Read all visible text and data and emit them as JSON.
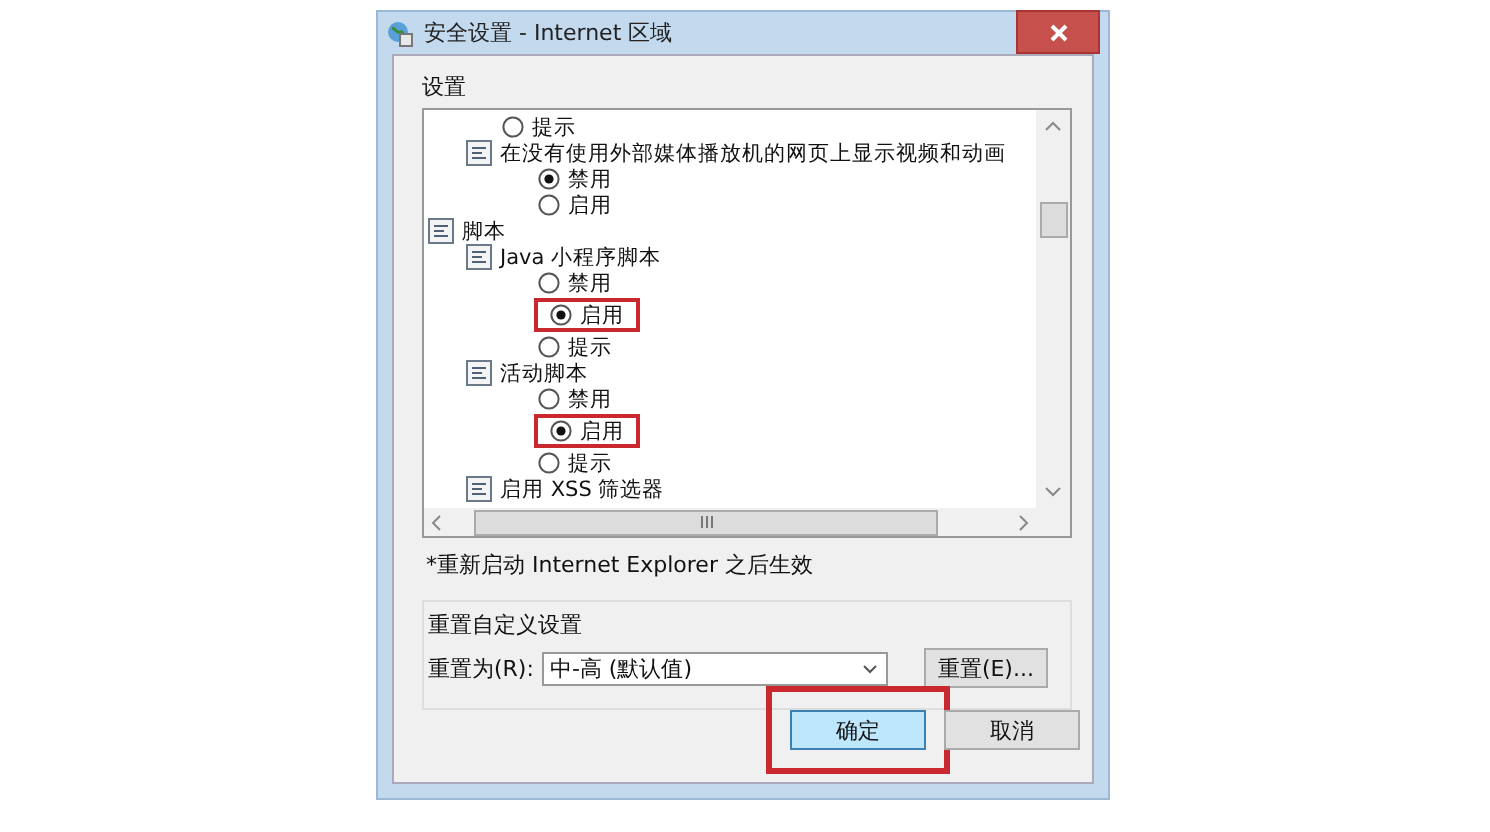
{
  "window": {
    "title": "安全设置 - Internet 区域"
  },
  "settings_label": "设置",
  "settings_list": [
    {
      "kind": "radio",
      "label": "提示",
      "selected": false,
      "highlighted": false
    },
    {
      "kind": "setting",
      "label": "在没有使用外部媒体播放机的网页上显示视频和动画",
      "children": [
        {
          "kind": "radio",
          "label": "禁用",
          "selected": true,
          "highlighted": false
        },
        {
          "kind": "radio",
          "label": "启用",
          "selected": false,
          "highlighted": false
        }
      ]
    },
    {
      "kind": "group",
      "label": "脚本",
      "children": [
        {
          "kind": "setting",
          "label": "Java 小程序脚本",
          "children": [
            {
              "kind": "radio",
              "label": "禁用",
              "selected": false,
              "highlighted": false
            },
            {
              "kind": "radio",
              "label": "启用",
              "selected": true,
              "highlighted": true
            },
            {
              "kind": "radio",
              "label": "提示",
              "selected": false,
              "highlighted": false
            }
          ]
        },
        {
          "kind": "setting",
          "label": "活动脚本",
          "children": [
            {
              "kind": "radio",
              "label": "禁用",
              "selected": false,
              "highlighted": false
            },
            {
              "kind": "radio",
              "label": "启用",
              "selected": true,
              "highlighted": true
            },
            {
              "kind": "radio",
              "label": "提示",
              "selected": false,
              "highlighted": false
            }
          ]
        },
        {
          "kind": "setting",
          "label": "启用 XSS 筛选器"
        }
      ]
    }
  ],
  "note": "*重新启动 Internet Explorer 之后生效",
  "reset_group": {
    "title": "重置自定义设置",
    "label": "重置为(R):",
    "value": "中-高 (默认值)",
    "button": "重置(E)..."
  },
  "buttons": [
    {
      "label": "确定",
      "default": true,
      "highlighted": true
    },
    {
      "label": "取消",
      "default": false,
      "highlighted": false
    }
  ]
}
